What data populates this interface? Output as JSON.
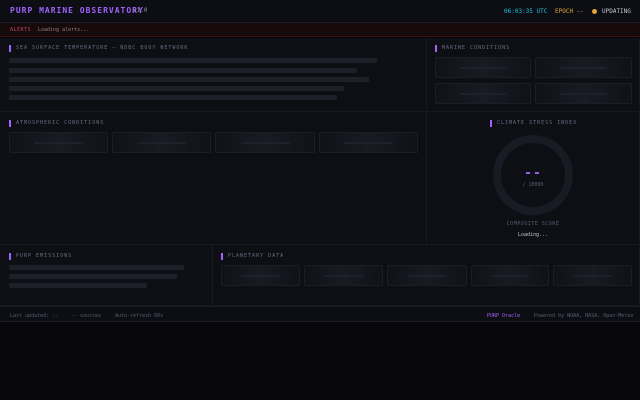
{
  "header": {
    "title": "PURP MARINE OBSERVATORY",
    "version": "v1.0",
    "utc_time": "06:03:35 UTC",
    "epoch": "EPOCH --",
    "status": "UPDATING",
    "status_color": "#e3a535",
    "accent_color": "#a063ff"
  },
  "alerts": {
    "label": "ALERTS",
    "text": "Loading alerts..."
  },
  "panels": {
    "sst": {
      "title": "SEA SURFACE TEMPERATURE — NDBC BUOY NETWORK"
    },
    "marine": {
      "title": "MARINE CONDITIONS"
    },
    "atmospheric": {
      "title": "ATMOSPHERIC CONDITIONS"
    },
    "climate": {
      "title": "CLIMATE STRESS INDEX",
      "value": "--",
      "max": "/ 10000",
      "label": "COMPOSITE SCORE",
      "loading": "Loading..."
    },
    "emissions": {
      "title": "PURP EMISSIONS"
    },
    "planetary": {
      "title": "PLANETARY DATA"
    }
  },
  "footer": {
    "last_updated": "Last updated: --",
    "sources": "-- sources",
    "refresh": "Auto-refresh 60s",
    "brand": "PURP Oracle",
    "powered": "Powered by NOAA, NASA, Open-Meteo",
    "separator": "·"
  }
}
